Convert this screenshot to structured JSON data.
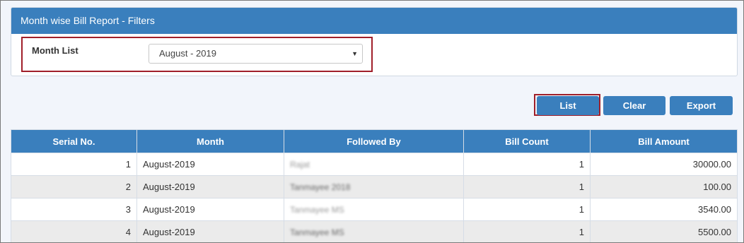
{
  "panel": {
    "title": "Month wise Bill Report - Filters",
    "month_label": "Month List",
    "month_value": "August - 2019"
  },
  "buttons": {
    "list": "List",
    "clear": "Clear",
    "export": "Export"
  },
  "table": {
    "headers": [
      "Serial No.",
      "Month",
      "Followed By",
      "Bill Count",
      "Bill Amount"
    ],
    "rows": [
      [
        "1",
        "August-2019",
        "Rajat",
        "1",
        "30000.00"
      ],
      [
        "2",
        "August-2019",
        "Tanmayee 2018",
        "1",
        "100.00"
      ],
      [
        "3",
        "August-2019",
        "Tanmayee MS",
        "1",
        "3540.00"
      ],
      [
        "4",
        "August-2019",
        "Tanmayee MS",
        "1",
        "5500.00"
      ]
    ]
  },
  "colors": {
    "header_blue": "#3a7fbd",
    "highlight_red": "#a01f2a",
    "row_alt": "#ebebeb"
  }
}
